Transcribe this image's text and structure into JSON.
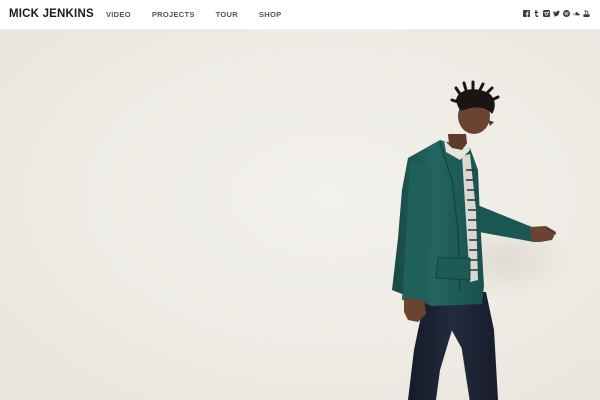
{
  "header": {
    "brand": "MICK JENKINS",
    "nav": [
      {
        "label": "VIDEO"
      },
      {
        "label": "PROJECTS"
      },
      {
        "label": "TOUR"
      },
      {
        "label": "SHOP"
      }
    ],
    "social_icons": [
      "facebook-icon",
      "tumblr-icon",
      "instagram-icon",
      "twitter-icon",
      "spotify-icon",
      "soundcloud-icon",
      "youtube-icon"
    ]
  },
  "hero": {
    "image_subject": "man-walking-in-green-jacket",
    "background_color": "#eeebe5",
    "jacket_color": "#1f5a55",
    "pants_color": "#1c2333"
  }
}
